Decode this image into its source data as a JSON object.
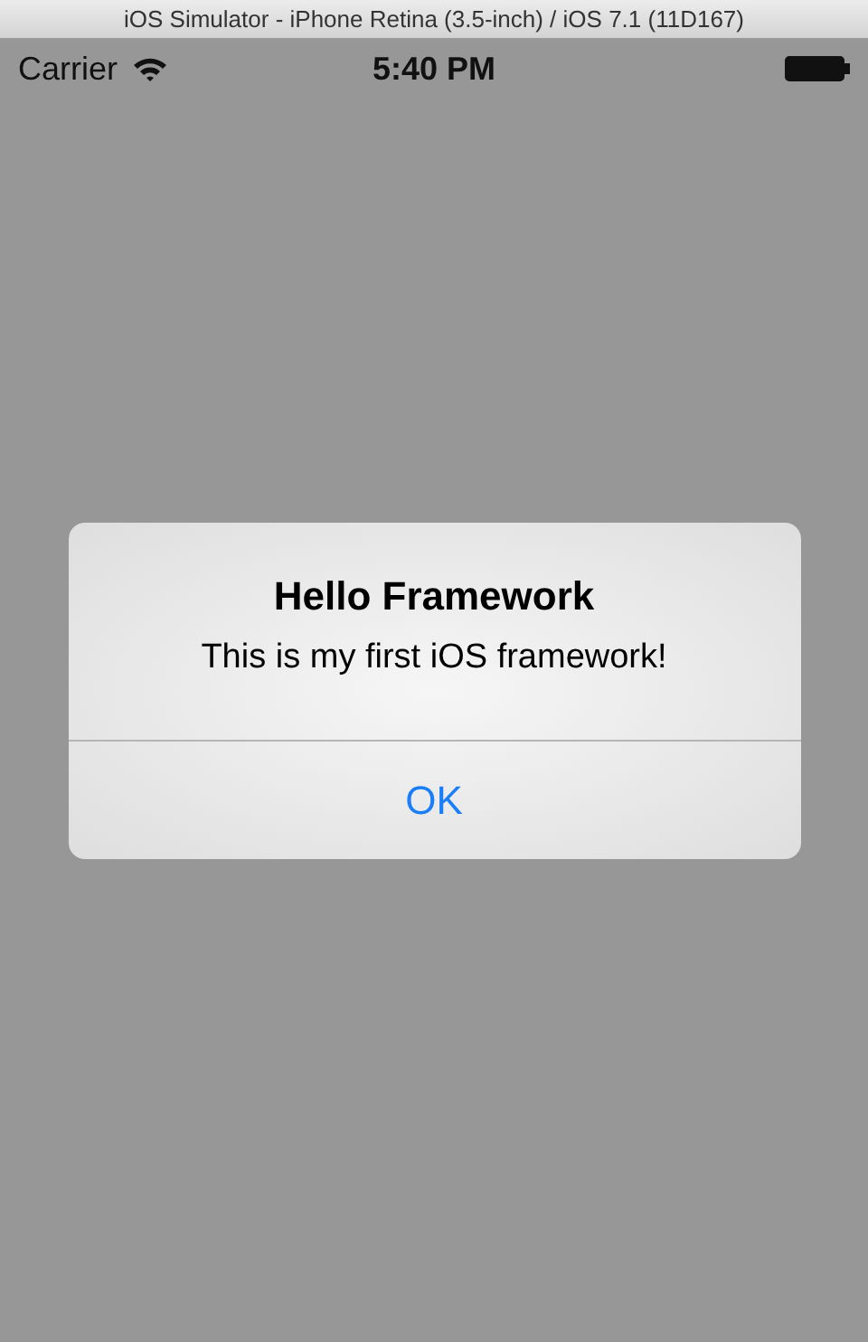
{
  "window": {
    "title": "iOS Simulator - iPhone Retina (3.5-inch) / iOS 7.1 (11D167)"
  },
  "status_bar": {
    "carrier": "Carrier",
    "time": "5:40 PM"
  },
  "alert": {
    "title": "Hello Framework",
    "message": "This is my first iOS framework!",
    "buttons": [
      "OK"
    ]
  }
}
